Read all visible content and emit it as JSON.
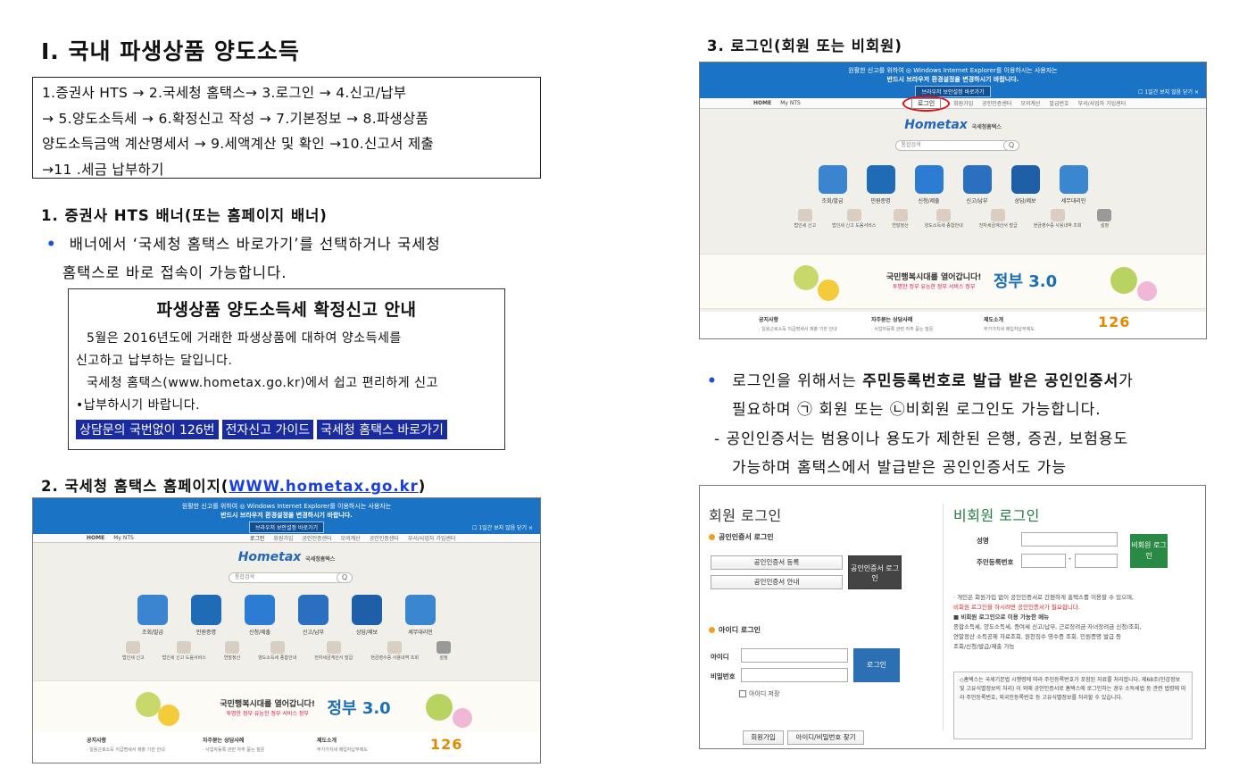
{
  "left": {
    "heading": "Ⅰ. 국내 파생상품 양도소득",
    "steps": [
      "1.증권사 HTS → 2.국세청 홈택스→ 3.로그인 → 4.신고/납부",
      "→ 5.양도소득세 → 6.확정신고 작성 → 7.기본정보 → 8.파생상품",
      "양도소득금액 계산명세서 → 9.세액계산 및 확인 →10.신고서 제출",
      "→11 .세금 납부하기"
    ],
    "sec1_title": "1. 증권사 HTS 배너(또는 홈페이지 배너)",
    "sec1_bullet_line1": "배너에서 ‘국세청 홈택스 바로가기’를 선택하거나 국세청",
    "sec1_bullet_line2": "홈택스로 바로 접속이 가능합니다.",
    "notice": {
      "title": "파생상품 양도소득세 확정신고 안내",
      "p1_line1": "5월은 2016년도에 거래한 파생상품에 대하여 양소득세를",
      "p1_line2": "신고하고 납부하는 달입니다.",
      "p2_line1": "국세청 홈택스(www.hometax.go.kr)에서 쉽고 편리하게 신고",
      "p2_line2": "•납부하시기 바랍니다.",
      "links": [
        "상담문의 국번없이 126번",
        "전자신고 가이드",
        "국세청 홈택스 바로가기"
      ]
    },
    "sec2_title_prefix": "2. 국세청 홈택스 홈페이지(",
    "sec2_url": "WWW.hometax.go.kr",
    "sec2_title_suffix": ")"
  },
  "right": {
    "sec3_title": "3. 로그인(회원 또는 비회원)",
    "bullet_line1_pre": "로그인을 위해서는 ",
    "bullet_line1_bold": "주민등록번호로 발급 받은 공인인증서",
    "bullet_line1_post": "가",
    "bullet_line2": "필요하며 ㉠ 회원 또는 ㉡비회원 로그인도 가능합니다.",
    "dash_line1": "- 공인인증서는 범용이나 용도가 제한된 은행, 증권, 보험용도",
    "dash_line2": "가능하며 홈택스에서 발급받은 공인인증서도 가능"
  },
  "hometax": {
    "bar_line1": "원활한 신고를 위하여 ◎ Windows Internet Explorer를 이용하시는 사용자는",
    "bar_line2": "반드시 브라우저 환경설정을 변경하시기 바랍니다.",
    "bar_button": "브라우저 보안설정 바로가기",
    "bar_tool": "☐ 1일간 보지 않음   닫기 ×",
    "nav_home": "HOME",
    "nav_myhts": "My NTS",
    "nav_login": "로그인",
    "nav_menu": [
      "회원가입",
      "공인인증센터",
      "모의계산",
      "공인인증센터",
      "발급번호",
      "부서/사업자 가입센터"
    ],
    "logo": "Hometax",
    "logo_sub": "국세청홈택스",
    "search_placeholder": "통합검색",
    "search_go": "Q",
    "icons": [
      "조회/발급",
      "민원증명",
      "신청/제출",
      "신고/납부",
      "상담/제보",
      "세무대리인"
    ],
    "small_icons": [
      "법인세 신고",
      "법인세 신고 도움서비스",
      "연말정산",
      "양도소득세 종합안내",
      "전자세금계산서 발급",
      "현금영수증 사용내역 조회",
      "설정"
    ],
    "banner_text": "국민행복시대를 열어갑니다!",
    "banner_sub": "투명한 정부 유능한 정부 서비스 정부",
    "banner_gov": "정부 3.0",
    "bottom_cols": [
      "공지사항",
      "자주묻는 상담사례",
      "제도소개"
    ],
    "bottom_lines": [
      "· 일용근로소득 지급명세서 제출 기한 안내",
      "· 사업자등록 관련 자주 묻는 질문",
      "부가가치세 매입자납부제도"
    ],
    "badge_126": "126"
  },
  "login": {
    "member_title": "회원 로그인",
    "cert_login": "공인인증서 로그인",
    "cert_register": "공인인증서 등록",
    "cert_guide": "공인인증서 안내",
    "cert_login_btn": "공인인증서 로그인",
    "id_login": "아이디 로그인",
    "id_label": "아이디",
    "pw_label": "비밀번호",
    "login_btn": "로그인",
    "save_id": "아이디 저장",
    "join_btn": "회원가입",
    "find_btn": "아이디/비밀번호 찾기",
    "guest_title": "비회원 로그인",
    "name_label": "성명",
    "rrn_label": "주민등록번호",
    "guest_btn": "비회원 로그인",
    "note1": "· 개인은 회원가입 없이 공인인증서로 간편하게 홈택스를 이용할 수 있으며,",
    "note2": "비회원 로그인을 하시려면 공인인증서가 필요합니다.",
    "note3": "■ 비회원 로그인으로 이용 가능한 메뉴",
    "note4": "종합소득세, 양도소득세, 증여세 신고/납부, 근로장려금·자녀장려금 신청/조회,",
    "note5": "연말정산 소득공제 자료조회, 원천징수 영수증 조회, 민원증명 발급 등",
    "note6": "조회/신청/발급/제출 가능",
    "box_text": "◇홈택스는 국세기본법 시행령에 따라 주민등록번호가 포함된 자료를 처리합니다. 제68조(민감정보 및 고유식별정보의 처리) 이 외에 공인인증서로 홈택스에 로그인하는 경우 소득세법 등 관련 법령에 따라 주민등록번호, 외국인등록번호 등 고유식별정보를 처리할 수 있습니다."
  },
  "colors": {
    "bullet": "#1f4fd8",
    "link_bg": "#1a2b9e",
    "hometax_blue": "#1b73c5",
    "login_ring": "#dd1111"
  }
}
